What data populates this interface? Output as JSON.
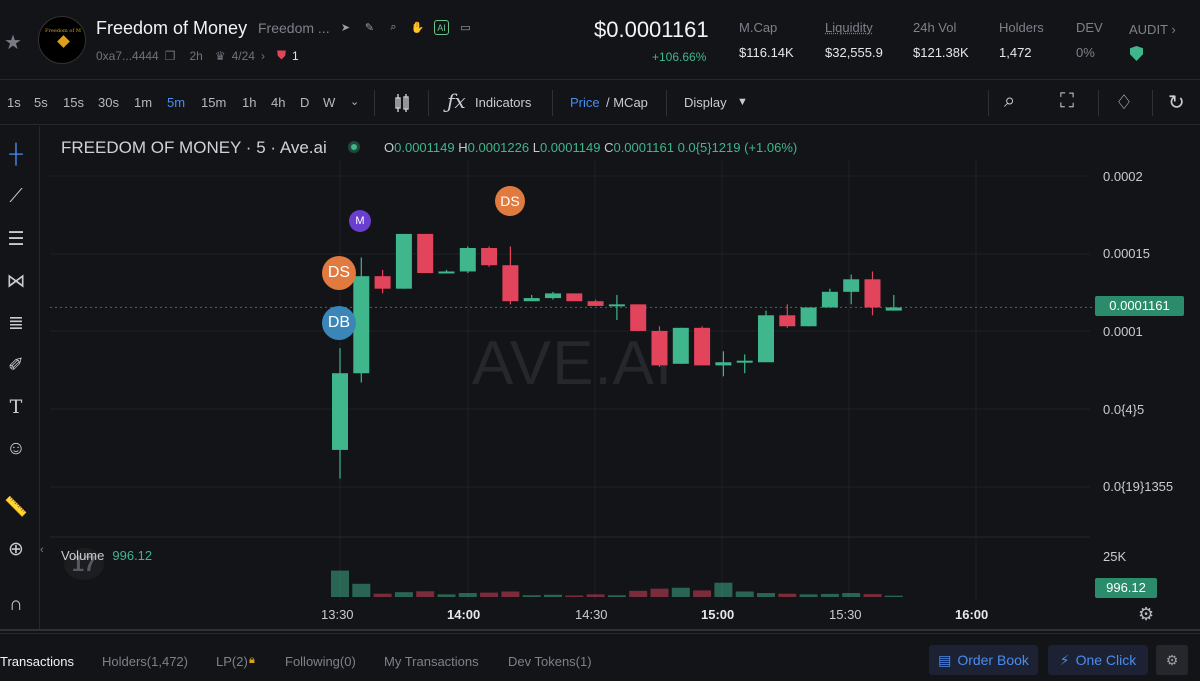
{
  "header": {
    "token_name": "Freedom of Money",
    "token_sub": "Freedom ...",
    "logo_text": "Freedom of M",
    "address": "0xa7...4444",
    "age": "2h",
    "ratio": "4/24",
    "red_count": "1",
    "price": "$0.0001161",
    "change": "+106.66%",
    "stats": [
      {
        "label": "M.Cap",
        "value": "$116.14K"
      },
      {
        "label": "Liquidity",
        "value": "$32,555.9"
      },
      {
        "label": "24h Vol",
        "value": "$121.38K"
      },
      {
        "label": "Holders",
        "value": "1,472"
      },
      {
        "label": "DEV",
        "value": "0%"
      }
    ],
    "audit_label": "AUDIT",
    "ai_badge": "AI"
  },
  "toolbar": {
    "timeframes": [
      "1s",
      "5s",
      "15s",
      "30s",
      "1m",
      "5m",
      "15m",
      "1h",
      "4h",
      "D",
      "W"
    ],
    "active_timeframe": "5m",
    "indicators_label": "Indicators",
    "price_label": "Price",
    "mcap_label": "/ MCap",
    "display_label": "Display"
  },
  "chart": {
    "title": "FREEDOM OF MONEY · 5 · Ave.ai",
    "ohlc": {
      "o": "0.0001149",
      "h": "0.0001226",
      "l": "0.0001149",
      "c": "0.0001161",
      "chg": "0.0{5}1219 (+1.06%)"
    },
    "y_labels": [
      "0.0002",
      "0.00015",
      "0.0001",
      "0.0{4}5",
      "0.0{19}1355"
    ],
    "current_price": "0.0001161",
    "volume_label": "Volume",
    "volume_value": "996.12",
    "volume_axis": "25K",
    "x_labels": [
      "13:30",
      "14:00",
      "14:30",
      "15:00",
      "15:30",
      "16:00"
    ],
    "watermark": "AVE.AI",
    "markers": [
      "M",
      "DS",
      "DS",
      "DB"
    ]
  },
  "chart_data": {
    "type": "candlestick",
    "candles": [
      {
        "o": 2.5e-05,
        "h": 9e-05,
        "l": 6.7e-06,
        "c": 7.4e-05,
        "v": 12000
      },
      {
        "o": 7.4e-05,
        "h": 0.000148,
        "l": 6.8e-05,
        "c": 0.000136,
        "v": 6000
      },
      {
        "o": 0.000136,
        "h": 0.00014,
        "l": 0.000125,
        "c": 0.000128,
        "v": 1500
      },
      {
        "o": 0.000128,
        "h": 0.000163,
        "l": 0.000128,
        "c": 0.000163,
        "v": 2200
      },
      {
        "o": 0.000163,
        "h": 0.000163,
        "l": 0.000138,
        "c": 0.000138,
        "v": 2600
      },
      {
        "o": 0.000138,
        "h": 0.00014,
        "l": 0.000138,
        "c": 0.000139,
        "v": 1200
      },
      {
        "o": 0.000139,
        "h": 0.000155,
        "l": 0.000138,
        "c": 0.000154,
        "v": 1800
      },
      {
        "o": 0.000154,
        "h": 0.000155,
        "l": 0.000142,
        "c": 0.000143,
        "v": 2000
      },
      {
        "o": 0.000143,
        "h": 0.000155,
        "l": 0.000118,
        "c": 0.00012,
        "v": 2500
      },
      {
        "o": 0.00012,
        "h": 0.000124,
        "l": 0.00012,
        "c": 0.000122,
        "v": 800
      },
      {
        "o": 0.000122,
        "h": 0.000126,
        "l": 0.000121,
        "c": 0.000125,
        "v": 1000
      },
      {
        "o": 0.000125,
        "h": 0.000125,
        "l": 0.00012,
        "c": 0.00012,
        "v": 700
      },
      {
        "o": 0.00012,
        "h": 0.000121,
        "l": 0.000117,
        "c": 0.000117,
        "v": 1200
      },
      {
        "o": 0.000117,
        "h": 0.000124,
        "l": 0.000108,
        "c": 0.000118,
        "v": 800
      },
      {
        "o": 0.000118,
        "h": 0.000118,
        "l": 0.000101,
        "c": 0.000101,
        "v": 2800
      },
      {
        "o": 0.000101,
        "h": 0.000104,
        "l": 7.8e-05,
        "c": 7.9e-05,
        "v": 3800
      },
      {
        "o": 8e-05,
        "h": 0.000103,
        "l": 8e-05,
        "c": 0.000103,
        "v": 4200
      },
      {
        "o": 0.000103,
        "h": 0.000104,
        "l": 7.9e-05,
        "c": 7.9e-05,
        "v": 3000
      },
      {
        "o": 7.9e-05,
        "h": 8.8e-05,
        "l": 7.2e-05,
        "c": 8.1e-05,
        "v": 6500
      },
      {
        "o": 8.1e-05,
        "h": 8.6e-05,
        "l": 7.4e-05,
        "c": 8.2e-05,
        "v": 2500
      },
      {
        "o": 8.1e-05,
        "h": 0.000114,
        "l": 8.1e-05,
        "c": 0.000111,
        "v": 1800
      },
      {
        "o": 0.000111,
        "h": 0.000118,
        "l": 0.000103,
        "c": 0.000104,
        "v": 1500
      },
      {
        "o": 0.000104,
        "h": 0.000116,
        "l": 0.000104,
        "c": 0.000116,
        "v": 1200
      },
      {
        "o": 0.000116,
        "h": 0.000128,
        "l": 0.000116,
        "c": 0.000126,
        "v": 1400
      },
      {
        "o": 0.000126,
        "h": 0.000137,
        "l": 0.000118,
        "c": 0.000134,
        "v": 1800
      },
      {
        "o": 0.000134,
        "h": 0.000139,
        "l": 0.000111,
        "c": 0.000116,
        "v": 1300
      },
      {
        "o": 0.000114,
        "h": 0.000124,
        "l": 0.000114,
        "c": 0.000116,
        "v": 600
      }
    ],
    "ylim": [
      1.3e-06,
      0.0002
    ],
    "x_ticks": [
      "13:30",
      "14:00",
      "14:30",
      "15:00",
      "15:30",
      "16:00"
    ],
    "volume_axis_max": 25000
  },
  "bottom": {
    "tabs": [
      "Transactions",
      "Holders(1,472)",
      "LP(2)",
      "Following(0)",
      "My Transactions",
      "Dev Tokens(1)"
    ],
    "order_book": "Order Book",
    "one_click": "One Click"
  },
  "colors": {
    "up": "#3fb68b",
    "down": "#e2445c",
    "accent": "#4a8cf0"
  }
}
